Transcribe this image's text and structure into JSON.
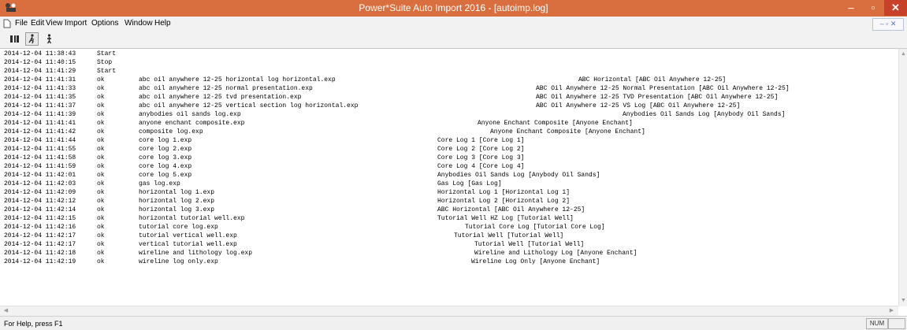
{
  "window": {
    "title": "Power*Suite Auto Import 2016 - [autoimp.log]",
    "controls": {
      "minimize": "–",
      "maximize": "▫",
      "close": "✕"
    },
    "accent": "#d96f3f"
  },
  "menu": {
    "items": [
      "File",
      "Edit",
      "View",
      "Import",
      "Options",
      "Window",
      "Help"
    ],
    "mdi_controls": "– ▫ ✕"
  },
  "toolbar": {
    "buttons": [
      "list-icon",
      "run-icon",
      "person-icon"
    ]
  },
  "log": {
    "rows": [
      {
        "timestamp": "2014-12-04 11:38:43",
        "status": "Start",
        "file": "",
        "log": ""
      },
      {
        "timestamp": "2014-12-04 11:40:15",
        "status": "Stop",
        "file": "",
        "log": ""
      },
      {
        "timestamp": "2014-12-04 11:41:29",
        "status": "Start",
        "file": "",
        "log": ""
      },
      {
        "timestamp": "2014-12-04 11:41:31",
        "status": "ok",
        "file": "abc oil anywhere 12-25 horizontal log horizontal.exp",
        "log": "ABC Horizontal [ABC Oil Anywhere 12-25]"
      },
      {
        "timestamp": "2014-12-04 11:41:33",
        "status": "ok",
        "file": "abc oil anywhere 12-25 normal presentation.exp",
        "log": "ABC Oil Anywhere 12-25 Normal Presentation [ABC Oil Anywhere 12-25]"
      },
      {
        "timestamp": "2014-12-04 11:41:35",
        "status": "ok",
        "file": "abc oil anywhere 12-25 tvd presentation.exp",
        "log": "ABC Oil Anywhere 12-25 TVD Presentation [ABC Oil Anywhere 12-25]"
      },
      {
        "timestamp": "2014-12-04 11:41:37",
        "status": "ok",
        "file": "abc oil anywhere 12-25 vertical section log horizontal.exp",
        "log": "ABC Oil Anywhere 12-25 VS Log [ABC Oil Anywhere 12-25]"
      },
      {
        "timestamp": "2014-12-04 11:41:39",
        "status": "ok",
        "file": "anybodies oil sands log.exp",
        "log": "Anybodies Oil Sands Log [Anybody Oil Sands]"
      },
      {
        "timestamp": "2014-12-04 11:41:41",
        "status": "ok",
        "file": "anyone enchant composite.exp",
        "log": "Anyone Enchant Composite [Anyone Enchant]"
      },
      {
        "timestamp": "2014-12-04 11:41:42",
        "status": "ok",
        "file": "composite log.exp",
        "log": "Anyone Enchant Composite [Anyone Enchant]"
      },
      {
        "timestamp": "2014-12-04 11:41:44",
        "status": "ok",
        "file": "core log 1.exp",
        "log": "Core Log 1 [Core Log 1]"
      },
      {
        "timestamp": "2014-12-04 11:41:55",
        "status": "ok",
        "file": "core log 2.exp",
        "log": "Core Log 2 [Core Log 2]"
      },
      {
        "timestamp": "2014-12-04 11:41:58",
        "status": "ok",
        "file": "core log 3.exp",
        "log": "Core Log 3 [Core Log 3]"
      },
      {
        "timestamp": "2014-12-04 11:41:59",
        "status": "ok",
        "file": "core log 4.exp",
        "log": "Core Log 4 [Core Log 4]"
      },
      {
        "timestamp": "2014-12-04 11:42:01",
        "status": "ok",
        "file": "core log 5.exp",
        "log": "Anybodies Oil Sands Log [Anybody Oil Sands]"
      },
      {
        "timestamp": "2014-12-04 11:42:03",
        "status": "ok",
        "file": "gas log.exp",
        "log": "Gas Log [Gas Log]"
      },
      {
        "timestamp": "2014-12-04 11:42:09",
        "status": "ok",
        "file": "horizontal log 1.exp",
        "log": "Horizontal Log 1 [Horizontal Log 1]"
      },
      {
        "timestamp": "2014-12-04 11:42:12",
        "status": "ok",
        "file": "horizontal log 2.exp",
        "log": "Horizontal Log 2 [Horizontal Log 2]"
      },
      {
        "timestamp": "2014-12-04 11:42:14",
        "status": "ok",
        "file": "horizontal log 3.exp",
        "log": "ABC Horizontal [ABC Oil Anywhere 12-25]"
      },
      {
        "timestamp": "2014-12-04 11:42:15",
        "status": "ok",
        "file": "horizontal tutorial well.exp",
        "log": "Tutorial Well HZ Log [Tutorial Well]"
      },
      {
        "timestamp": "2014-12-04 11:42:16",
        "status": "ok",
        "file": "tutorial core log.exp",
        "log": "Tutorial Core Log [Tutorial Core Log]"
      },
      {
        "timestamp": "2014-12-04 11:42:17",
        "status": "ok",
        "file": "tutorial vertical well.exp",
        "log": "Tutorial Well [Tutorial Well]"
      },
      {
        "timestamp": "2014-12-04 11:42:17",
        "status": "ok",
        "file": "vertical tutorial well.exp",
        "log": "Tutorial Well [Tutorial Well]"
      },
      {
        "timestamp": "2014-12-04 11:42:18",
        "status": "ok",
        "file": "wireline and lithology log.exp",
        "log": "Wireline and Lithology Log [Anyone Enchant]"
      },
      {
        "timestamp": "2014-12-04 11:42:19",
        "status": "ok",
        "file": "wireline log only.exp",
        "log": "Wireline Log Only [Anyone Enchant]"
      }
    ]
  },
  "statusbar": {
    "help_text": "For Help, press F1",
    "num_indicator": "NUM"
  }
}
